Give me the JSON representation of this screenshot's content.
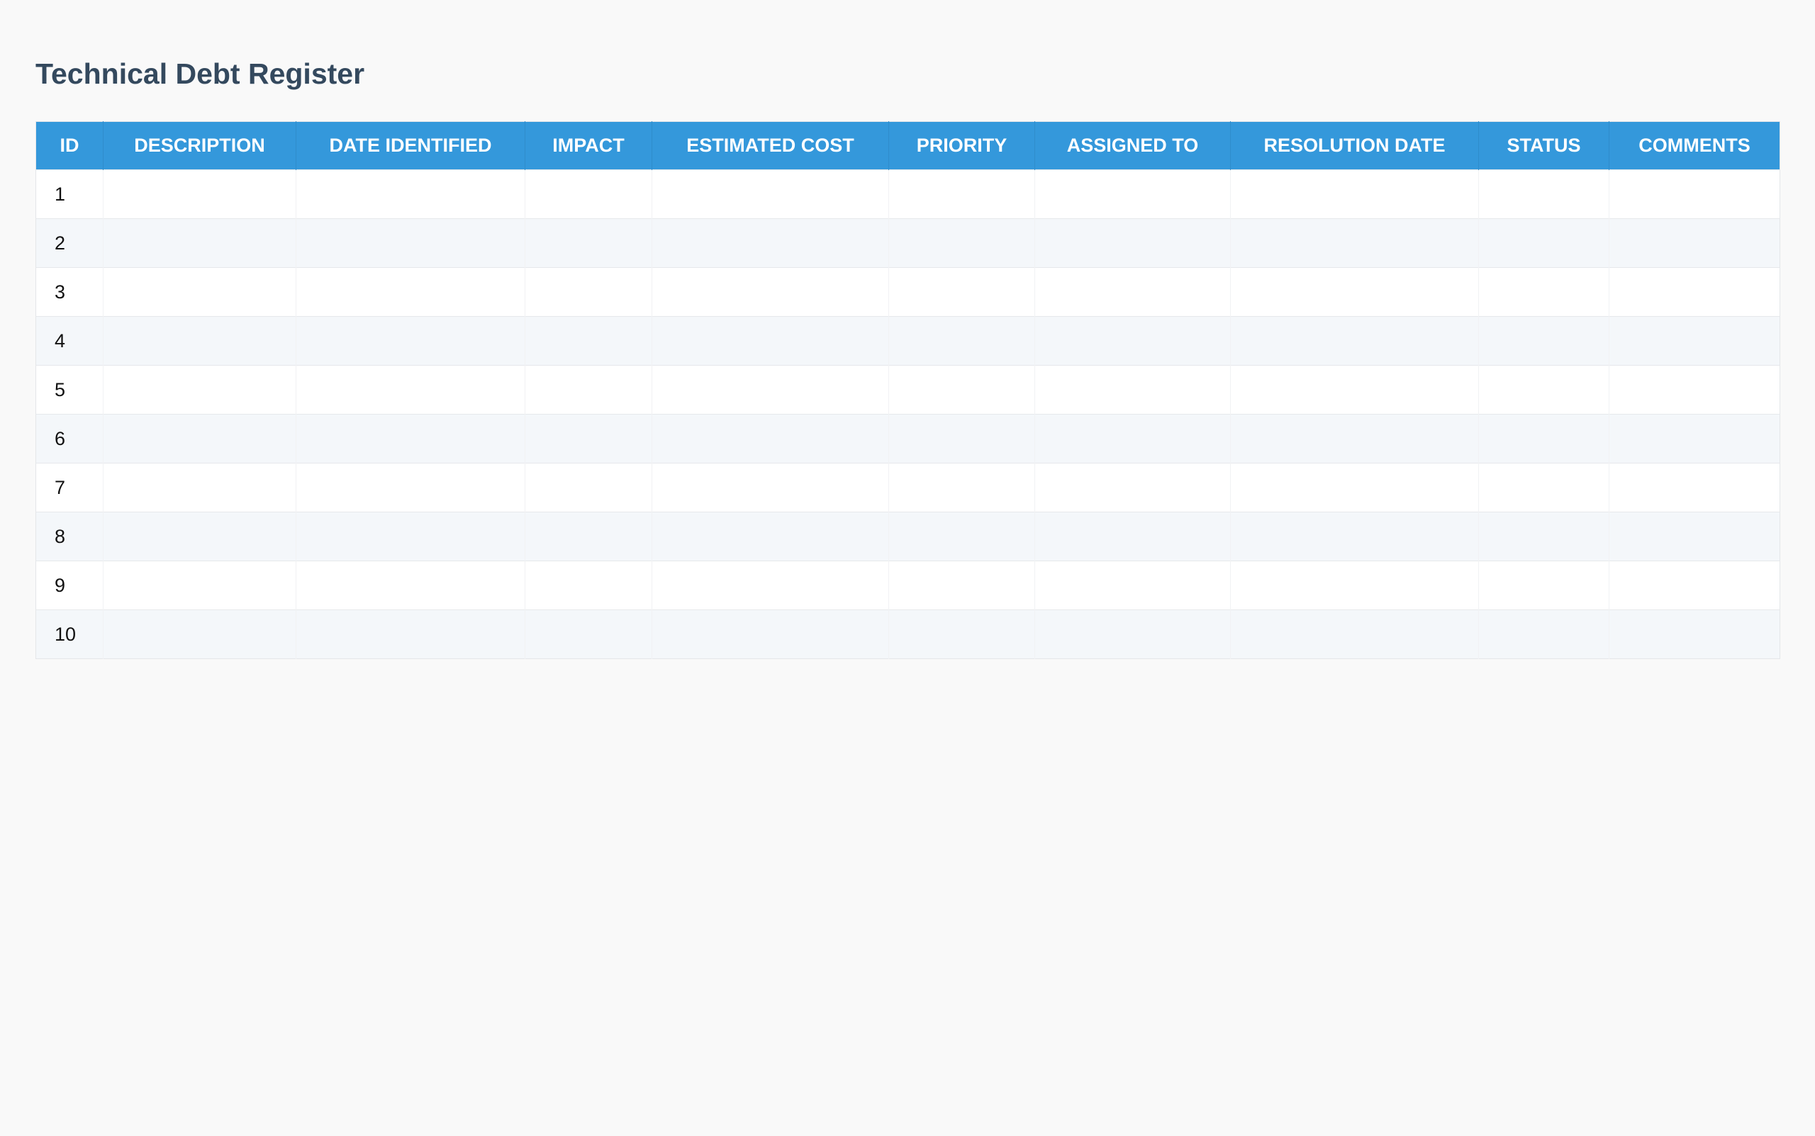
{
  "page": {
    "title": "Technical Debt Register"
  },
  "table": {
    "columns": [
      "ID",
      "DESCRIPTION",
      "DATE IDENTIFIED",
      "IMPACT",
      "ESTIMATED COST",
      "PRIORITY",
      "ASSIGNED TO",
      "RESOLUTION DATE",
      "STATUS",
      "COMMENTS"
    ],
    "rows": [
      {
        "id": "1"
      },
      {
        "id": "2"
      },
      {
        "id": "3"
      },
      {
        "id": "4"
      },
      {
        "id": "5"
      },
      {
        "id": "6"
      },
      {
        "id": "7"
      },
      {
        "id": "8"
      },
      {
        "id": "9"
      },
      {
        "id": "10"
      }
    ]
  },
  "colors": {
    "header_background": "#3498db",
    "header_text": "#ffffff",
    "title_text": "#34495e",
    "row_alt_background": "#f4f7fa",
    "page_background": "#f9f9f9"
  }
}
